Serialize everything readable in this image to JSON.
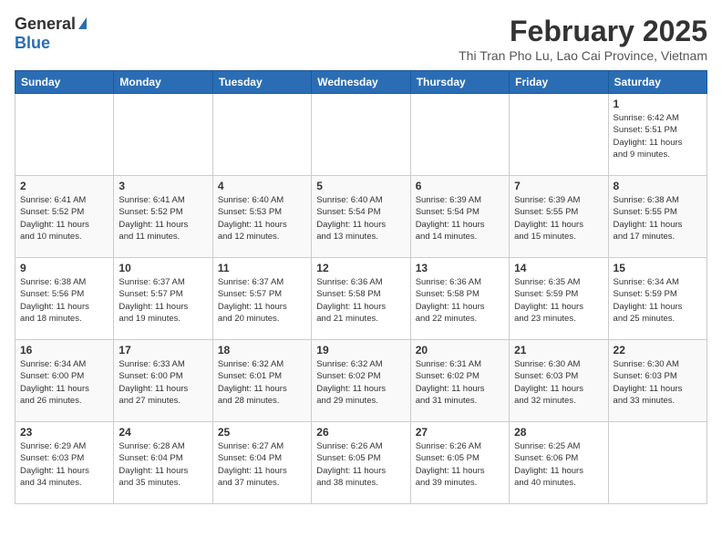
{
  "header": {
    "logo_general": "General",
    "logo_blue": "Blue",
    "month_title": "February 2025",
    "location": "Thi Tran Pho Lu, Lao Cai Province, Vietnam"
  },
  "days_of_week": [
    "Sunday",
    "Monday",
    "Tuesday",
    "Wednesday",
    "Thursday",
    "Friday",
    "Saturday"
  ],
  "weeks": [
    [
      {
        "day": "",
        "info": ""
      },
      {
        "day": "",
        "info": ""
      },
      {
        "day": "",
        "info": ""
      },
      {
        "day": "",
        "info": ""
      },
      {
        "day": "",
        "info": ""
      },
      {
        "day": "",
        "info": ""
      },
      {
        "day": "1",
        "info": "Sunrise: 6:42 AM\nSunset: 5:51 PM\nDaylight: 11 hours\nand 9 minutes."
      }
    ],
    [
      {
        "day": "2",
        "info": "Sunrise: 6:41 AM\nSunset: 5:52 PM\nDaylight: 11 hours\nand 10 minutes."
      },
      {
        "day": "3",
        "info": "Sunrise: 6:41 AM\nSunset: 5:52 PM\nDaylight: 11 hours\nand 11 minutes."
      },
      {
        "day": "4",
        "info": "Sunrise: 6:40 AM\nSunset: 5:53 PM\nDaylight: 11 hours\nand 12 minutes."
      },
      {
        "day": "5",
        "info": "Sunrise: 6:40 AM\nSunset: 5:54 PM\nDaylight: 11 hours\nand 13 minutes."
      },
      {
        "day": "6",
        "info": "Sunrise: 6:39 AM\nSunset: 5:54 PM\nDaylight: 11 hours\nand 14 minutes."
      },
      {
        "day": "7",
        "info": "Sunrise: 6:39 AM\nSunset: 5:55 PM\nDaylight: 11 hours\nand 15 minutes."
      },
      {
        "day": "8",
        "info": "Sunrise: 6:38 AM\nSunset: 5:55 PM\nDaylight: 11 hours\nand 17 minutes."
      }
    ],
    [
      {
        "day": "9",
        "info": "Sunrise: 6:38 AM\nSunset: 5:56 PM\nDaylight: 11 hours\nand 18 minutes."
      },
      {
        "day": "10",
        "info": "Sunrise: 6:37 AM\nSunset: 5:57 PM\nDaylight: 11 hours\nand 19 minutes."
      },
      {
        "day": "11",
        "info": "Sunrise: 6:37 AM\nSunset: 5:57 PM\nDaylight: 11 hours\nand 20 minutes."
      },
      {
        "day": "12",
        "info": "Sunrise: 6:36 AM\nSunset: 5:58 PM\nDaylight: 11 hours\nand 21 minutes."
      },
      {
        "day": "13",
        "info": "Sunrise: 6:36 AM\nSunset: 5:58 PM\nDaylight: 11 hours\nand 22 minutes."
      },
      {
        "day": "14",
        "info": "Sunrise: 6:35 AM\nSunset: 5:59 PM\nDaylight: 11 hours\nand 23 minutes."
      },
      {
        "day": "15",
        "info": "Sunrise: 6:34 AM\nSunset: 5:59 PM\nDaylight: 11 hours\nand 25 minutes."
      }
    ],
    [
      {
        "day": "16",
        "info": "Sunrise: 6:34 AM\nSunset: 6:00 PM\nDaylight: 11 hours\nand 26 minutes."
      },
      {
        "day": "17",
        "info": "Sunrise: 6:33 AM\nSunset: 6:00 PM\nDaylight: 11 hours\nand 27 minutes."
      },
      {
        "day": "18",
        "info": "Sunrise: 6:32 AM\nSunset: 6:01 PM\nDaylight: 11 hours\nand 28 minutes."
      },
      {
        "day": "19",
        "info": "Sunrise: 6:32 AM\nSunset: 6:02 PM\nDaylight: 11 hours\nand 29 minutes."
      },
      {
        "day": "20",
        "info": "Sunrise: 6:31 AM\nSunset: 6:02 PM\nDaylight: 11 hours\nand 31 minutes."
      },
      {
        "day": "21",
        "info": "Sunrise: 6:30 AM\nSunset: 6:03 PM\nDaylight: 11 hours\nand 32 minutes."
      },
      {
        "day": "22",
        "info": "Sunrise: 6:30 AM\nSunset: 6:03 PM\nDaylight: 11 hours\nand 33 minutes."
      }
    ],
    [
      {
        "day": "23",
        "info": "Sunrise: 6:29 AM\nSunset: 6:03 PM\nDaylight: 11 hours\nand 34 minutes."
      },
      {
        "day": "24",
        "info": "Sunrise: 6:28 AM\nSunset: 6:04 PM\nDaylight: 11 hours\nand 35 minutes."
      },
      {
        "day": "25",
        "info": "Sunrise: 6:27 AM\nSunset: 6:04 PM\nDaylight: 11 hours\nand 37 minutes."
      },
      {
        "day": "26",
        "info": "Sunrise: 6:26 AM\nSunset: 6:05 PM\nDaylight: 11 hours\nand 38 minutes."
      },
      {
        "day": "27",
        "info": "Sunrise: 6:26 AM\nSunset: 6:05 PM\nDaylight: 11 hours\nand 39 minutes."
      },
      {
        "day": "28",
        "info": "Sunrise: 6:25 AM\nSunset: 6:06 PM\nDaylight: 11 hours\nand 40 minutes."
      },
      {
        "day": "",
        "info": ""
      }
    ]
  ]
}
